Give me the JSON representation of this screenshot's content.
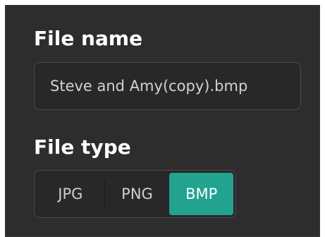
{
  "file_name": {
    "label": "File name",
    "value": "Steve and Amy(copy).bmp"
  },
  "file_type": {
    "label": "File type",
    "options": [
      "JPG",
      "PNG",
      "BMP"
    ],
    "selected": "BMP"
  },
  "colors": {
    "panel_background": "#2d2d2d",
    "field_background": "#282828",
    "accent": "#22a38f",
    "text": "#ffffff"
  }
}
